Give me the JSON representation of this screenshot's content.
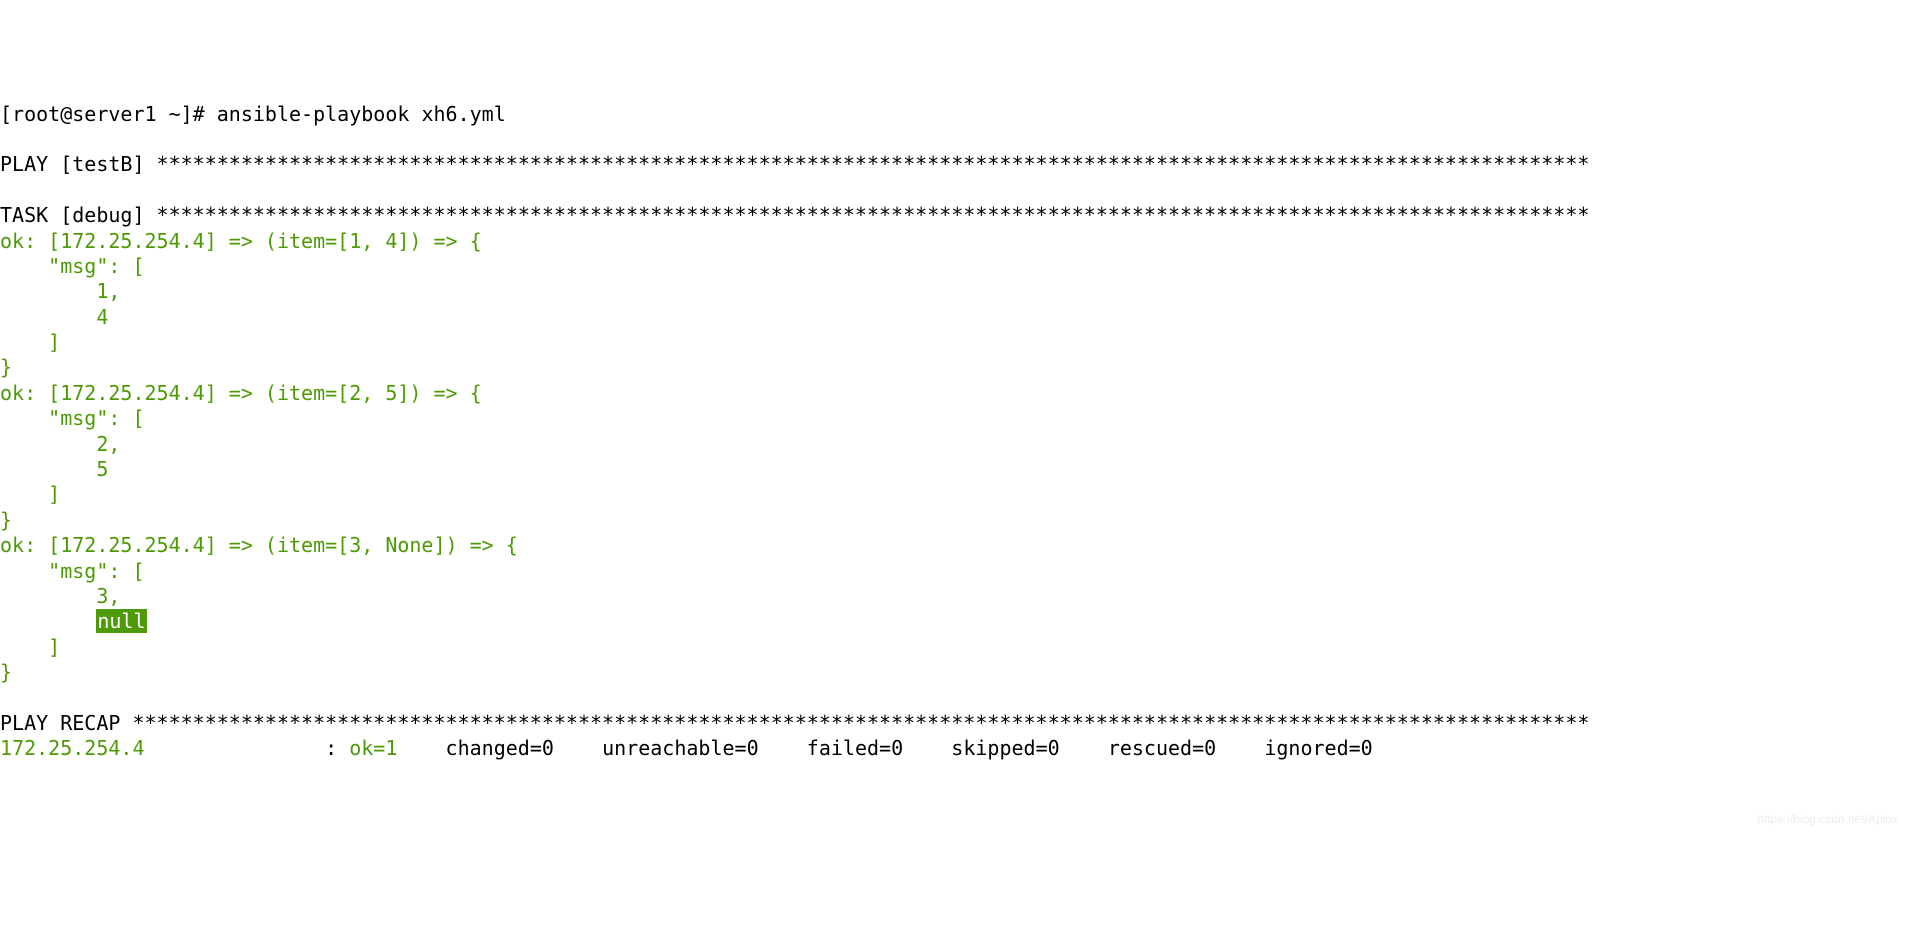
{
  "prompt": "[root@server1 ~]# ",
  "command": "ansible-playbook xh6.yml",
  "blank": "",
  "play_line": "PLAY [testB] ***********************************************************************************************************************",
  "task_line": "TASK [debug] ***********************************************************************************************************************",
  "item1": {
    "head": "ok: [172.25.254.4] => (item=[1, 4]) => {",
    "msg": "    \"msg\": [",
    "v1": "        1,",
    "v2": "        4",
    "close_arr": "    ]",
    "close_obj": "}"
  },
  "item2": {
    "head": "ok: [172.25.254.4] => (item=[2, 5]) => {",
    "msg": "    \"msg\": [",
    "v1": "        2,",
    "v2": "        5",
    "close_arr": "    ]",
    "close_obj": "}"
  },
  "item3": {
    "head": "ok: [172.25.254.4] => (item=[3, None]) => {",
    "msg": "    \"msg\": [",
    "v1": "        3,",
    "pad": "        ",
    "null": "null",
    "close_arr": "    ]",
    "close_obj": "}"
  },
  "recap_line": "PLAY RECAP *************************************************************************************************************************",
  "recap": {
    "host": "172.25.254.4",
    "pad": "               ",
    "colon": ": ",
    "ok": "ok=1   ",
    "rest": " changed=0    unreachable=0    failed=0    skipped=0    rescued=0    ignored=0"
  },
  "watermark": "https://blog.csdn.net/Aplox"
}
